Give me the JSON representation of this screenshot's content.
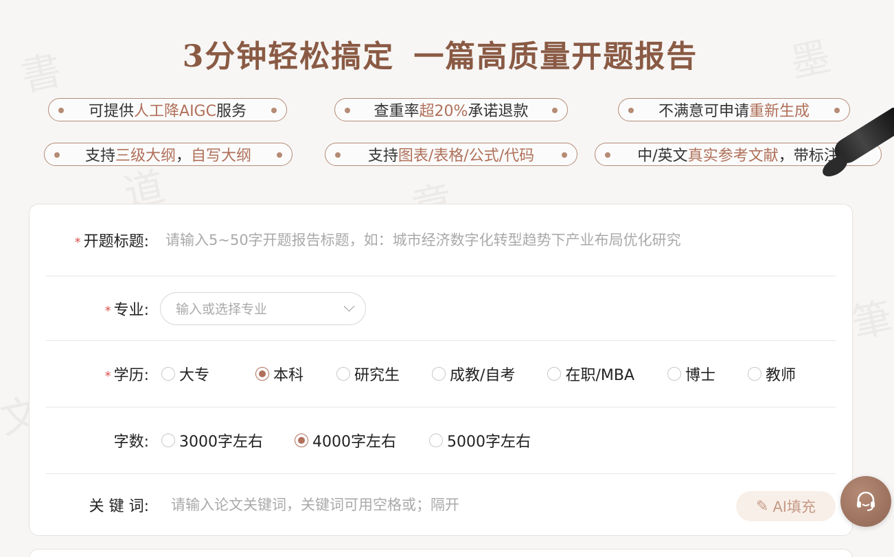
{
  "hero": {
    "title_a": "3分钟轻松搞定",
    "title_b": "一篇高质量开题报告"
  },
  "features": [
    {
      "pre": "可提供",
      "hl": "人工降AIGC",
      "post": "服务"
    },
    {
      "pre": "查重率",
      "hl": "超20%",
      "post": "承诺退款"
    },
    {
      "pre": "不满意可申请",
      "hl": "重新生成",
      "post": ""
    },
    {
      "pre": "支持",
      "hl": "三级大纲",
      "mid": "，",
      "hl2": "自写大纲",
      "post": ""
    },
    {
      "pre": "支持",
      "hl": "图表/表格/公式/代码",
      "post": ""
    },
    {
      "pre": "中/英文",
      "hl": "真实参考文献",
      "post": "，带标注"
    }
  ],
  "form": {
    "title_label": "开题标题:",
    "title_placeholder": "请输入5~50字开题报告标题，如：城市经济数字化转型趋势下产业布局优化研究",
    "major_label": "专业:",
    "major_placeholder": "输入或选择专业",
    "edu_label": "学历:",
    "edu_options": [
      "大专",
      "本科",
      "研究生",
      "成教/自考",
      "在职/MBA",
      "博士",
      "教师"
    ],
    "edu_selected": "本科",
    "words_label": "字数:",
    "words_options": [
      "3000字左右",
      "4000字左右",
      "5000字左右"
    ],
    "words_selected": "4000字左右",
    "keywords_label": "关 键 词:",
    "keywords_placeholder": "请输入论文关键词，关键词可用空格或；隔开",
    "ai_fill_label": "AI填充"
  },
  "icons": {
    "ai_fill": "feather-pen-icon",
    "support": "headset-icon"
  },
  "colors": {
    "accent": "#b0705a",
    "title": "#8a5a44",
    "required": "#d9534f"
  }
}
